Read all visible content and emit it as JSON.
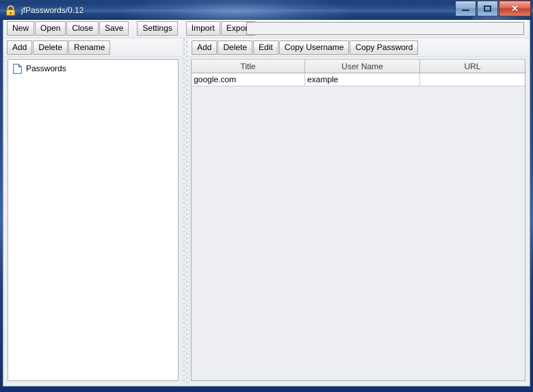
{
  "window": {
    "title": "jfPasswords/0.12",
    "icon": "padlock-icon",
    "controls": {
      "minimize": "–",
      "maximize": "□",
      "close": "✕"
    },
    "frame_color": "#1b3c73",
    "titlebar_text_color": "#ffffff"
  },
  "toolbar": {
    "file_group": [
      {
        "label": "New",
        "name": "new-button"
      },
      {
        "label": "Open",
        "name": "open-button"
      },
      {
        "label": "Close",
        "name": "close-button"
      },
      {
        "label": "Save",
        "name": "save-button"
      }
    ],
    "settings_group": [
      {
        "label": "Settings",
        "name": "settings-button"
      }
    ],
    "transfer_group": [
      {
        "label": "Import",
        "name": "import-button"
      },
      {
        "label": "Export",
        "name": "export-button"
      }
    ],
    "search": {
      "value": "",
      "placeholder": ""
    }
  },
  "left_panel": {
    "toolbar": [
      {
        "label": "Add",
        "name": "tree-add-button"
      },
      {
        "label": "Delete",
        "name": "tree-delete-button"
      },
      {
        "label": "Rename",
        "name": "tree-rename-button"
      }
    ],
    "tree": {
      "nodes": [
        {
          "label": "Passwords",
          "icon": "document-icon"
        }
      ]
    }
  },
  "right_panel": {
    "toolbar": [
      {
        "label": "Add",
        "name": "entry-add-button"
      },
      {
        "label": "Delete",
        "name": "entry-delete-button"
      },
      {
        "label": "Edit",
        "name": "entry-edit-button"
      },
      {
        "label": "Copy Username",
        "name": "copy-username-button"
      },
      {
        "label": "Copy Password",
        "name": "copy-password-button"
      }
    ],
    "table": {
      "columns": [
        "Title",
        "User Name",
        "URL"
      ],
      "rows": [
        {
          "title": "google.com",
          "user_name": "example",
          "url": ""
        }
      ]
    }
  },
  "colors": {
    "panel_background": "#eceef1",
    "table_viewport": "#eceef1",
    "tree_background": "#ffffff",
    "header_background": "#eceeef",
    "icon_gold": "#f4c236"
  }
}
